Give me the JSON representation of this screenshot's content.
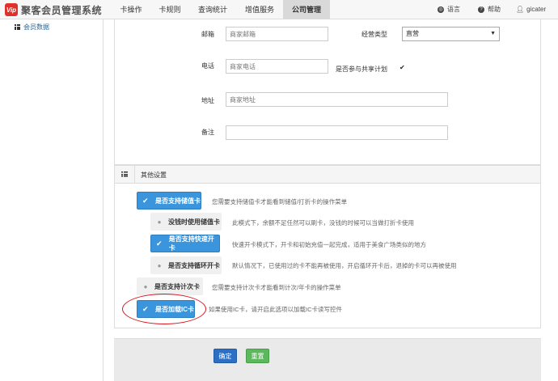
{
  "app": {
    "logo_badge": "Vip",
    "title": "聚客会员管理系统"
  },
  "nav": {
    "items": [
      {
        "label": "卡操作"
      },
      {
        "label": "卡规则"
      },
      {
        "label": "查询统计"
      },
      {
        "label": "增值服务"
      },
      {
        "label": "公司管理"
      }
    ],
    "right": {
      "language": "语言",
      "help": "帮助",
      "user": "gicater"
    }
  },
  "sidebar": {
    "items": [
      {
        "label": "会员数据"
      }
    ]
  },
  "form": {
    "email_label": "邮箱",
    "email_placeholder": "商家邮箱",
    "biztype_label": "经营类型",
    "biztype_value": "直营",
    "phone_label": "电话",
    "phone_placeholder": "商家电话",
    "share_label": "是否参与共享计划",
    "share_checked": "✔",
    "address_label": "地址",
    "address_placeholder": "商家地址",
    "remark_label": "备注",
    "remark_value": ""
  },
  "other_settings": {
    "title": "其他设置",
    "options": [
      {
        "label": "是否支持储值卡",
        "state": "on",
        "desc": "您需要支持储值卡才能看到储值/打折卡的操作菜单"
      },
      {
        "label": "没钱时使用储值卡",
        "state": "off",
        "desc": "此模式下，余额不足任然可以刷卡，没钱的时候可以当做打折卡使用"
      },
      {
        "label": "是否支持快速开卡",
        "state": "on",
        "desc": "快速开卡模式下，开卡和初始充值一起完成，适用于美食广场类似的地方"
      },
      {
        "label": "是否支持循环开卡",
        "state": "off",
        "desc": "默认情况下，已使用过的卡不能再被使用，开启循环开卡后，退掉的卡可以再被使用"
      },
      {
        "label": "是否支持计次卡",
        "state": "off",
        "desc": "您需要支持计次卡才能看到计次/年卡的操作菜单"
      },
      {
        "label": "是否加载IC卡",
        "state": "on",
        "desc": "如果使用IC卡，请开启此选项以加载IC卡读写控件"
      }
    ]
  },
  "footer": {
    "confirm_label": "确定",
    "reset_label": "重置"
  },
  "colors": {
    "toggle_on": "#3a95dd",
    "confirm": "#2d6fc4",
    "reset": "#5cb85c",
    "annotation_ring": "#d9141c"
  }
}
